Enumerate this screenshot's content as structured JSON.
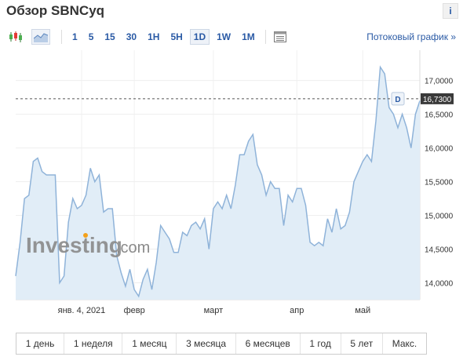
{
  "header": {
    "title": "Обзор SBNCyq",
    "info_label": "i"
  },
  "toolbar": {
    "chart_type_icons": [
      "candlestick-icon",
      "area-chart-icon"
    ],
    "timeframes": [
      "1",
      "5",
      "15",
      "30",
      "1H",
      "5H",
      "1D",
      "1W",
      "1M"
    ],
    "active_timeframe": "1D",
    "table_icon": "table-icon",
    "stream_link": "Потоковый график »"
  },
  "watermark": {
    "brand": "Investing",
    "suffix": ".com"
  },
  "chart_data": {
    "type": "area",
    "title": "",
    "x_ticks": [
      "янв. 4, 2021",
      "февр",
      "март",
      "апр",
      "май"
    ],
    "y_ticks": [
      "17,0000",
      "16,5000",
      "16,0000",
      "15,5000",
      "15,0000",
      "14,5000",
      "14,0000"
    ],
    "ylim": [
      13.75,
      17.45
    ],
    "current_value": 16.73,
    "current_label": "16,7300",
    "marker_label": "D",
    "grid": true,
    "series": [
      {
        "values": [
          14.1,
          14.6,
          15.25,
          15.3,
          15.8,
          15.85,
          15.65,
          15.6,
          15.6,
          15.6,
          14.0,
          14.1,
          14.9,
          15.25,
          15.1,
          15.15,
          15.3,
          15.7,
          15.5,
          15.6,
          15.05,
          15.1,
          15.1,
          14.4,
          14.15,
          13.95,
          14.2,
          13.9,
          13.8,
          14.05,
          14.2,
          13.9,
          14.3,
          14.85,
          14.75,
          14.65,
          14.45,
          14.45,
          14.75,
          14.7,
          14.85,
          14.9,
          14.8,
          14.95,
          14.5,
          15.1,
          15.2,
          15.1,
          15.3,
          15.1,
          15.45,
          15.9,
          15.9,
          16.1,
          16.2,
          15.75,
          15.6,
          15.3,
          15.5,
          15.4,
          15.4,
          14.85,
          15.3,
          15.2,
          15.4,
          15.4,
          15.15,
          14.6,
          14.55,
          14.6,
          14.55,
          14.95,
          14.75,
          15.1,
          14.8,
          14.85,
          15.05,
          15.5,
          15.65,
          15.8,
          15.9,
          15.8,
          16.4,
          17.2,
          17.1,
          16.6,
          16.5,
          16.3,
          16.5,
          16.3,
          16.0,
          16.5,
          16.7
        ]
      }
    ]
  }
}
